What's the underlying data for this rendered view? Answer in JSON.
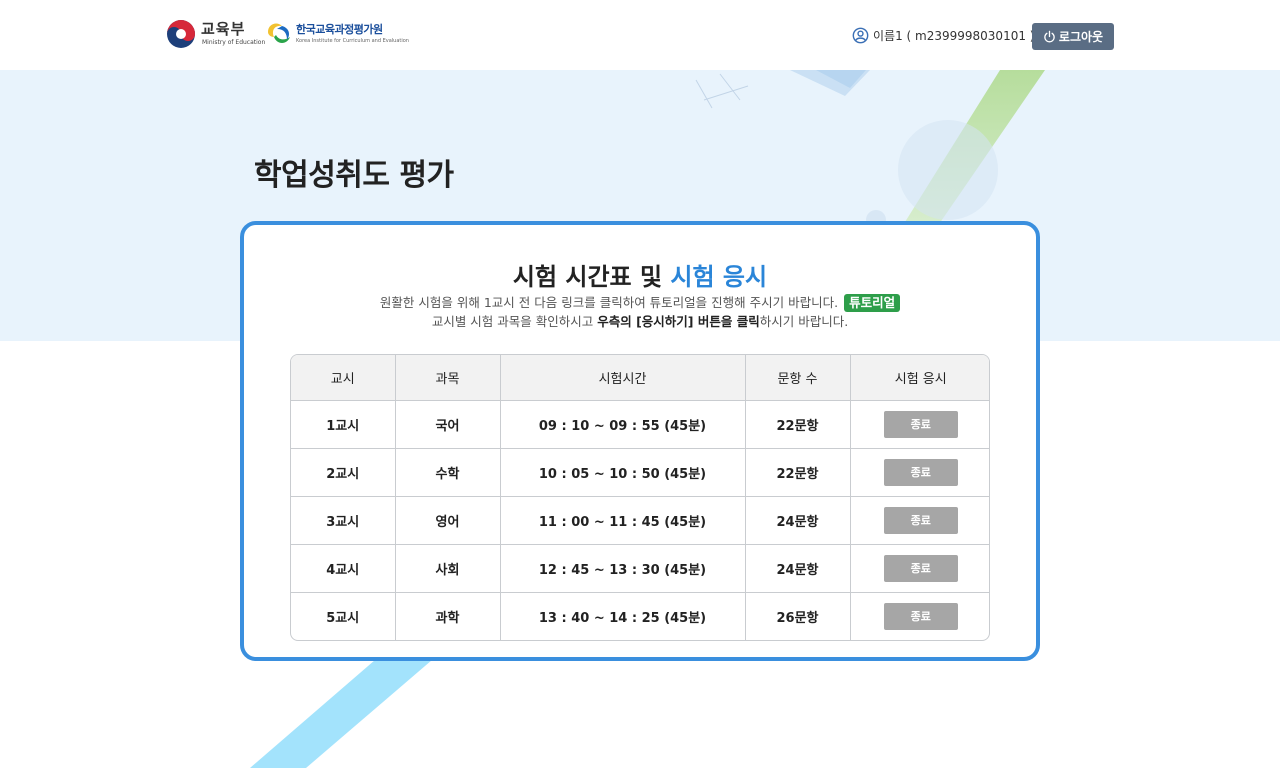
{
  "header": {
    "moe_logo": {
      "name": "교육부",
      "english": "Ministry of Education"
    },
    "kice_logo": {
      "name": "한국교육과정평가원",
      "english": "Korea Institute for Curriculum and Evaluation"
    },
    "user": {
      "icon": "user-circle-icon",
      "text": "이름1 ( m2399998030101 )"
    },
    "logout": {
      "icon": "power-icon",
      "label": "로그아웃"
    }
  },
  "page_title": "학업성취도 평가",
  "card": {
    "title_main": "시험 시간표 및 ",
    "title_accent": "시험 응시",
    "notice_line1": "원활한 시험을 위해 1교시 전 다음 링크를 클릭하여 튜토리얼을 진행해 주시기 바랍니다.",
    "tutorial_label": "튜토리얼",
    "notice_line2_prefix": "교시별 시험 과목을 확인하시고 ",
    "notice_line2_bold": "우측의 [응시하기] 버튼을 클릭",
    "notice_line2_suffix": "하시기 바랍니다."
  },
  "table": {
    "headers": [
      "교시",
      "과목",
      "시험시간",
      "문항 수",
      "시험 응시"
    ],
    "rows": [
      {
        "period": "1교시",
        "subject": "국어",
        "time": "09 : 10 ~ 09 : 55 (45분)",
        "count": "22문항",
        "status": "종료"
      },
      {
        "period": "2교시",
        "subject": "수학",
        "time": "10 : 05 ~ 10 : 50 (45분)",
        "count": "22문항",
        "status": "종료"
      },
      {
        "period": "3교시",
        "subject": "영어",
        "time": "11 : 00 ~ 11 : 45 (45분)",
        "count": "24문항",
        "status": "종료"
      },
      {
        "period": "4교시",
        "subject": "사회",
        "time": "12 : 45 ~ 13 : 30 (45분)",
        "count": "24문항",
        "status": "종료"
      },
      {
        "period": "5교시",
        "subject": "과학",
        "time": "13 : 40 ~ 14 : 25 (45분)",
        "count": "26문항",
        "status": "종료"
      }
    ]
  },
  "colors": {
    "accent": "#2a85d8",
    "card_border": "#3a8fde",
    "hero_bg": "#e8f3fc",
    "tutorial_green": "#2e9e4a",
    "logout_bg": "#5a6d84",
    "end_button": "#a6a6a6"
  }
}
